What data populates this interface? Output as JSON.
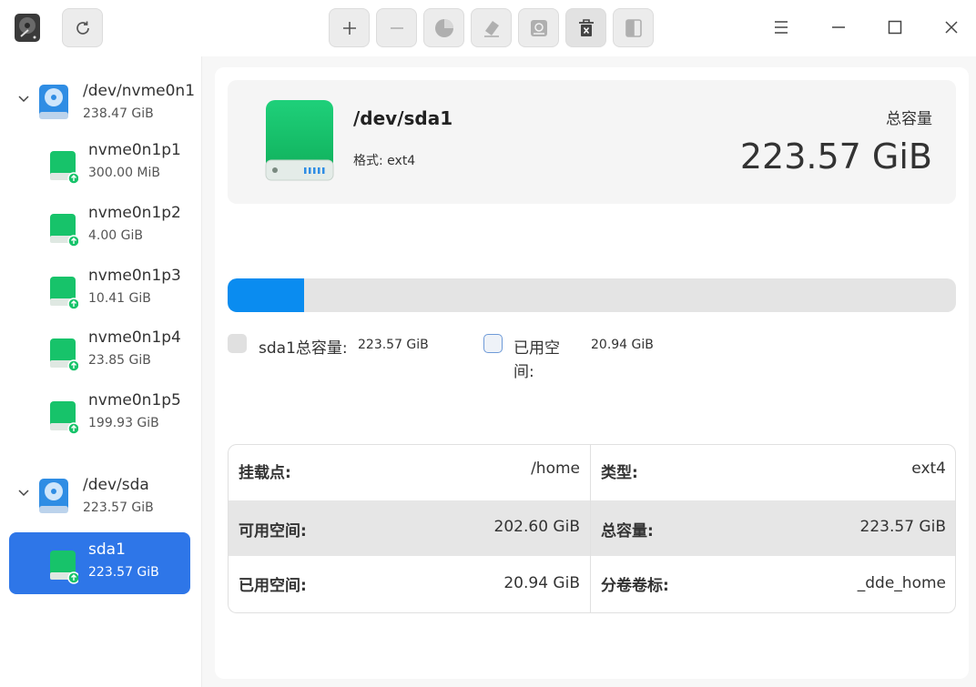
{
  "toolbar": {
    "refresh_icon": "refresh-icon",
    "buttons": [
      {
        "name": "add-partition-button",
        "icon": "plus-icon"
      },
      {
        "name": "delete-partition-button",
        "icon": "minus-icon"
      },
      {
        "name": "partition-button",
        "icon": "pie-chart-icon"
      },
      {
        "name": "wipe-button",
        "icon": "eraser-icon"
      },
      {
        "name": "format-button",
        "icon": "format-icon"
      },
      {
        "name": "unmount-button",
        "icon": "trash-icon"
      },
      {
        "name": "resize-button",
        "icon": "split-icon"
      }
    ]
  },
  "sidebar": {
    "disks": [
      {
        "name": "/dev/nvme0n1",
        "size": "238.47 GiB",
        "partitions": [
          {
            "name": "nvme0n1p1",
            "size": "300.00 MiB"
          },
          {
            "name": "nvme0n1p2",
            "size": "4.00 GiB"
          },
          {
            "name": "nvme0n1p3",
            "size": "10.41 GiB"
          },
          {
            "name": "nvme0n1p4",
            "size": "23.85 GiB"
          },
          {
            "name": "nvme0n1p5",
            "size": "199.93 GiB"
          }
        ]
      },
      {
        "name": "/dev/sda",
        "size": "223.57 GiB",
        "partitions": [
          {
            "name": "sda1",
            "size": "223.57 GiB",
            "selected": true
          }
        ]
      }
    ]
  },
  "detail": {
    "device": "/dev/sda1",
    "format": "格式: ext4",
    "total_label": "总容量",
    "total_value": "223.57 GiB",
    "usage_fraction": 0.105,
    "legend": {
      "total_label": "sda1总容量:",
      "total_value": "223.57 GiB",
      "used_label_1": "已用空",
      "used_label_2": "间:",
      "used_value": "20.94 GiB"
    },
    "props": {
      "mount_label": "挂载点:",
      "mount_value": "/home",
      "type_label": "类型:",
      "type_value": "ext4",
      "free_label": "可用空间:",
      "free_value": "202.60 GiB",
      "cap_label": "总容量:",
      "cap_value": "223.57 GiB",
      "used_label": "已用空间:",
      "used_value": "20.94 GiB",
      "vol_label": "分卷卷标:",
      "vol_value": "_dde_home"
    }
  },
  "colors": {
    "accent": "#2e76e8",
    "usage": "#0a8cf0",
    "partition_green": "#17c36a"
  }
}
